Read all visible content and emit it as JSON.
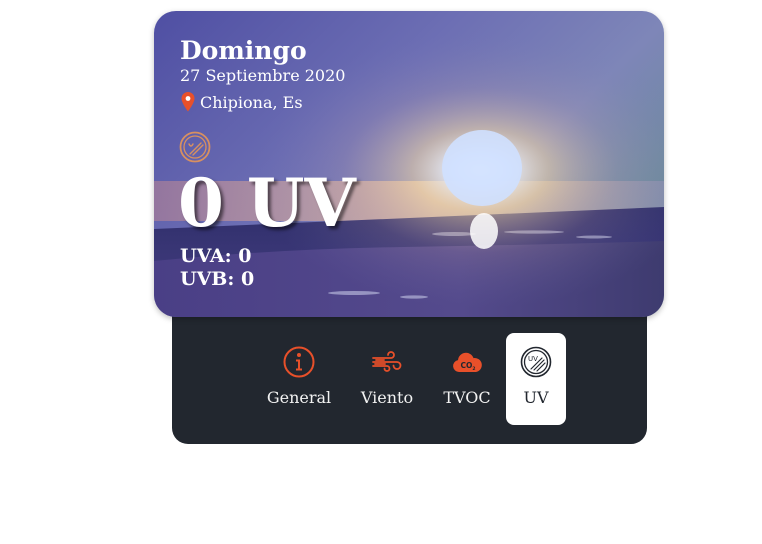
{
  "card": {
    "day": "Domingo",
    "date": "27 Septiembre 2020",
    "location": "Chipiona, Es",
    "uv_value": "0 UV",
    "uva": "UVA: 0",
    "uvb": "UVB: 0",
    "icons": {
      "location": "map-pin-icon",
      "uv_badge": "uv-sun-icon"
    }
  },
  "tabs": [
    {
      "id": "general",
      "label": "General",
      "icon": "info-icon",
      "active": false
    },
    {
      "id": "viento",
      "label": "Viento",
      "icon": "wind-icon",
      "active": false
    },
    {
      "id": "tvoc",
      "label": "TVOC",
      "icon": "co2-cloud-icon",
      "active": false
    },
    {
      "id": "uv",
      "label": "UV",
      "icon": "uv-icon",
      "active": true
    }
  ],
  "colors": {
    "accent": "#e8502a",
    "panel": "#22272f",
    "active_tab": "#ffffff",
    "text_light": "#ffffff"
  }
}
